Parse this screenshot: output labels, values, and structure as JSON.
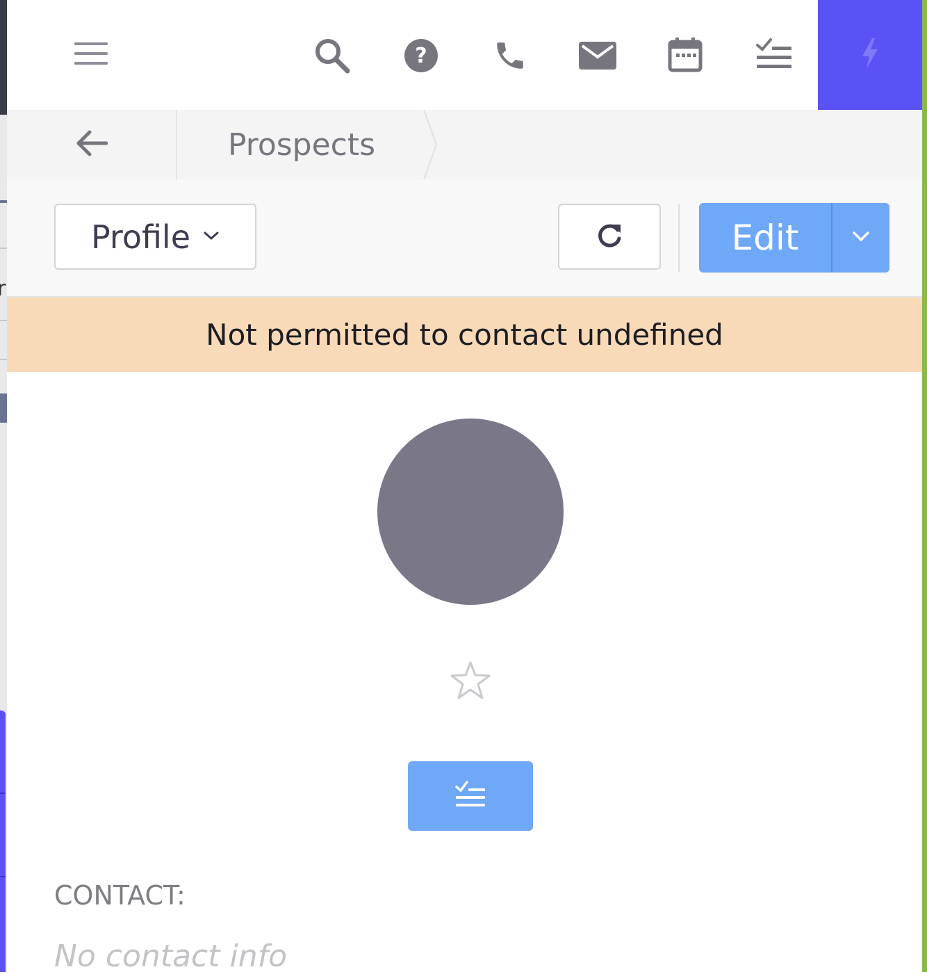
{
  "toolbar": {
    "icons": [
      "menu-icon",
      "search-icon",
      "help-icon",
      "phone-icon",
      "mail-icon",
      "calendar-icon",
      "task-list-icon",
      "lightning-icon"
    ]
  },
  "breadcrumb": {
    "current": "Prospects"
  },
  "actions": {
    "profile_label": "Profile",
    "edit_label": "Edit"
  },
  "banner": {
    "message": "Not permitted to contact undefined"
  },
  "contact": {
    "heading": "CONTACT:",
    "empty_text": "No contact info"
  },
  "colors": {
    "accent": "#5b52f5",
    "primary_button": "#6ea8f7",
    "warning_banner": "#f8d9b8",
    "avatar": "#7a7788",
    "icon": "#77767e"
  }
}
